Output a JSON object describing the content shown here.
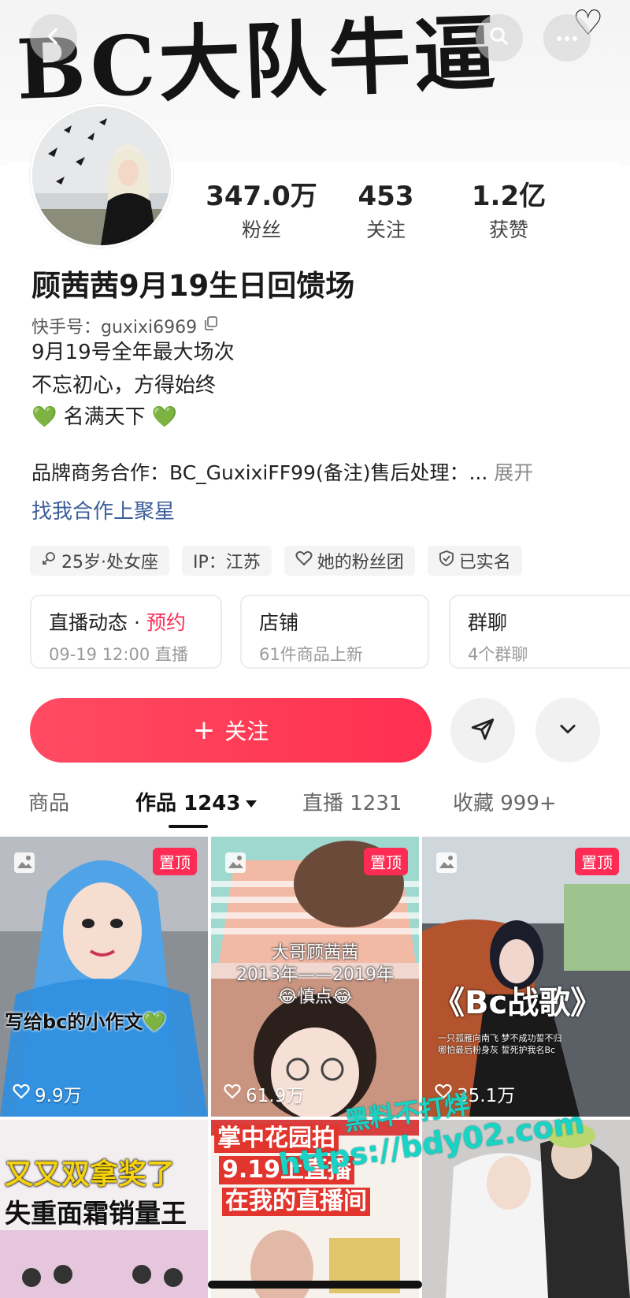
{
  "header": {
    "banner_text": "BC大队牛逼",
    "banner_heart": "♡",
    "back_icon": "chevron-left-icon",
    "search_icon": "search-icon",
    "more_icon": "more-dots-icon"
  },
  "stats": [
    {
      "value": "347.0万",
      "label": "粉丝"
    },
    {
      "value": "453",
      "label": "关注"
    },
    {
      "value": "1.2亿",
      "label": "获赞"
    }
  ],
  "profile": {
    "name": "顾茜茜9月19生日回馈场",
    "kuaishou_id": "快手号：guxixi6969",
    "bio": [
      "9月19号全年最大场次",
      "不忘初心，方得始终",
      "💚 名满天下 💚"
    ],
    "brand_line": "品牌商务合作：BC_GuxixiFF99(备注)售后处理：...",
    "expand_label": "展开",
    "star_link": "找我合作上聚星"
  },
  "tags": [
    {
      "icon": "gender-icon",
      "label": "25岁·处女座"
    },
    {
      "icon": "",
      "label": "IP：江苏"
    },
    {
      "icon": "heart-outline-icon",
      "label": "她的粉丝团"
    },
    {
      "icon": "verified-shield-icon",
      "label": "已实名"
    }
  ],
  "features": [
    {
      "title": "直播动态",
      "title_accent": "预约",
      "separator": " · ",
      "subtitle": "09-19 12:00 直播"
    },
    {
      "title": "店铺",
      "subtitle": "61件商品上新"
    },
    {
      "title": "群聊",
      "subtitle": "4个群聊"
    }
  ],
  "actions": {
    "follow_label": "关注",
    "follow_plus": "+",
    "share_icon": "send-icon",
    "dropdown_icon": "chevron-down-icon"
  },
  "tabs": [
    {
      "label": "商品"
    },
    {
      "label": "作品 1243"
    },
    {
      "label": "直播 1231"
    },
    {
      "label": "收藏 999+"
    }
  ],
  "posts": [
    {
      "pinned": "置顶",
      "caption": "写给bc的小作文💚",
      "likes": "9.9万"
    },
    {
      "pinned": "置顶",
      "caption_lines": [
        "大哥顾茜茜",
        "2013年——2019年",
        "😂慎点😂"
      ],
      "likes": "61.9万"
    },
    {
      "pinned": "置顶",
      "caption": "《Bc战歌》",
      "caption_small": [
        "一只孤雁向南飞 梦不成功誓不归",
        "哪怕最后粉身灰 誓死护我名Bc"
      ],
      "likes": "35.1万"
    },
    {
      "caption_lines": [
        "又又双拿奖了",
        "失重面霜销量王"
      ]
    },
    {
      "caption_lines": [
        "掌中花园拍",
        "9.19上直播",
        "在我的直播间"
      ]
    },
    {}
  ],
  "watermark": {
    "line1": "黑料不打烊",
    "line2": "https://bdy02.com"
  },
  "colors": {
    "accent": "#fe2c55",
    "link": "#3d5e9a",
    "watermark": "#19d3c5"
  }
}
